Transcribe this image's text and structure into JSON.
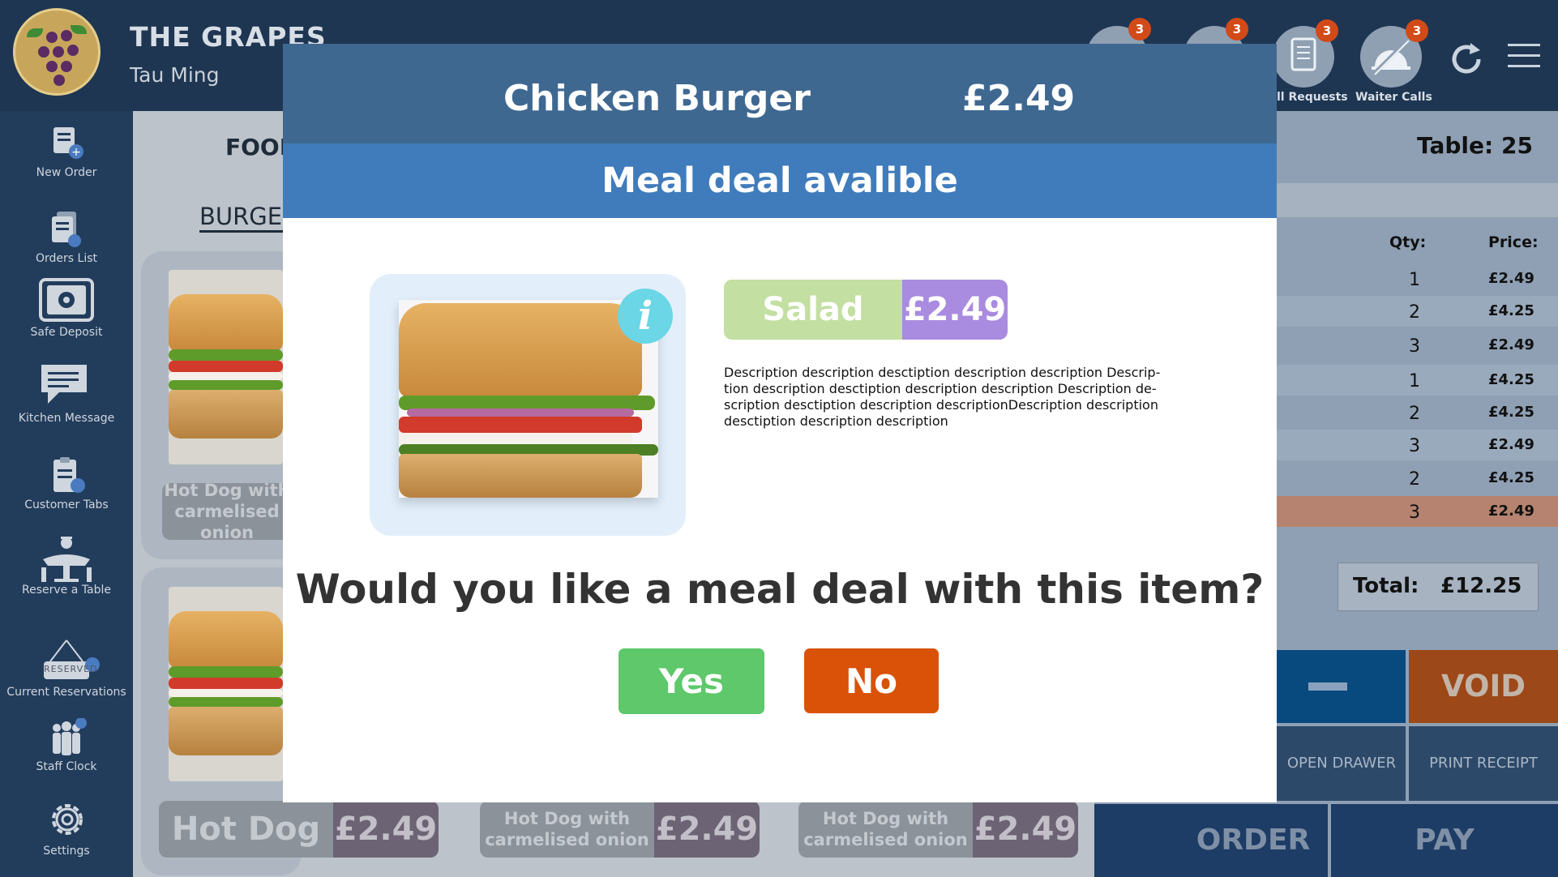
{
  "header": {
    "brand": "THE GRAPES",
    "user": "Tau Ming",
    "icons": [
      {
        "name": "tables",
        "badge": "3",
        "label": ""
      },
      {
        "name": "payments",
        "badge": "3",
        "label": ""
      },
      {
        "name": "bill-requests",
        "badge": "3",
        "label": "ll Requests"
      },
      {
        "name": "waiter-calls",
        "badge": "3",
        "label": "Waiter Calls"
      }
    ]
  },
  "sidebar": {
    "items": [
      {
        "label": "New Order",
        "icon": "new-order-icon"
      },
      {
        "label": "Orders List",
        "icon": "orders-list-icon"
      },
      {
        "label": "Safe Deposit",
        "icon": "safe-icon"
      },
      {
        "label": "Kitchen Message",
        "icon": "message-icon"
      },
      {
        "label": "Customer Tabs",
        "icon": "clipboard-icon"
      },
      {
        "label": "Reserve a Table",
        "icon": "table-icon"
      },
      {
        "label": "Current Reservations",
        "icon": "reserved-sign-icon",
        "sign": "RESERVED"
      },
      {
        "label": "Staff Clock",
        "icon": "staff-icon"
      },
      {
        "label": "Settings",
        "icon": "gear-icon"
      }
    ]
  },
  "main": {
    "category": "FOOD",
    "tab": "BURGERS",
    "products": [
      {
        "name": "Hot Dog with carmelised onion",
        "price": ""
      },
      {
        "name": "Hot Dog",
        "price": "£2.49"
      },
      {
        "name": "Hot Dog with carmelised onion",
        "price": "£2.49"
      },
      {
        "name": "Hot Dog with carmelised onion",
        "price": "£2.49"
      }
    ]
  },
  "order": {
    "table": "Table: 25",
    "qty_header": "Qty:",
    "price_header": "Price:",
    "rows": [
      {
        "qty": "1",
        "price": "£2.49"
      },
      {
        "qty": "2",
        "price": "£4.25"
      },
      {
        "qty": "3",
        "price": "£2.49"
      },
      {
        "qty": "1",
        "price": "£4.25"
      },
      {
        "qty": "2",
        "price": "£4.25"
      },
      {
        "qty": "3",
        "price": "£2.49"
      },
      {
        "qty": "2",
        "price": "£4.25"
      },
      {
        "qty": "3",
        "price": "£2.49",
        "highlight": true
      }
    ],
    "total_label": "Total:",
    "total_value": "£12.25",
    "minus": "—",
    "void": "VOID",
    "open_drawer": "OPEN DRAWER",
    "print_receipt": "PRINT RECEIPT",
    "order_btn": "ORDER",
    "pay_btn": "PAY"
  },
  "modal": {
    "item_name": "Chicken Burger",
    "item_price": "£2.49",
    "subtitle": "Meal deal avalible",
    "option_name": "Salad",
    "option_price": "£2.49",
    "description": "Description description desctiption description description Descrip-tion description desctiption description description Description de-scription desctiption description descriptionDescription description desctiption description description",
    "question": "Would you like a meal deal with this item?",
    "yes": "Yes",
    "no": "No"
  },
  "colors": {
    "header_bg": "#1e3652",
    "modal_head": "#3f6891",
    "modal_sub": "#407cbc",
    "yes": "#5ec86a",
    "no": "#d95208",
    "option_name": "#c3dfa2",
    "option_price": "#a98be0",
    "badge": "#d24a18"
  }
}
